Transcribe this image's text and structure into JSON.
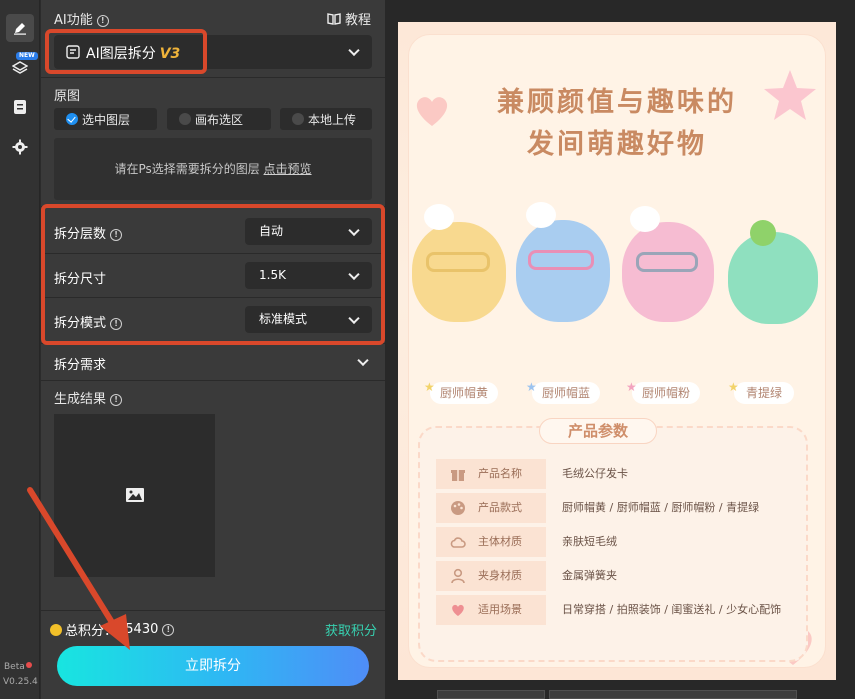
{
  "panel": {
    "ai_function_label": "AI功能",
    "tutorial_label": "教程",
    "function_select": {
      "label": "AI图层拆分",
      "version": "V3"
    },
    "source_label": "原图",
    "source_options": [
      "选中图层",
      "画布选区",
      "本地上传"
    ],
    "source_selected": "选中图层",
    "preview_hint": "请在Ps选择需要拆分的图层",
    "preview_link": "点击预览",
    "layers_label": "拆分层数",
    "layers_value": "自动",
    "size_label": "拆分尺寸",
    "size_value": "1.5K",
    "mode_label": "拆分模式",
    "mode_value": "标准模式",
    "requirements_label": "拆分需求",
    "result_label": "生成结果",
    "score_label": "总积分：",
    "score_value": "15430",
    "get_score_label": "获取积分",
    "go_button": "立即拆分"
  },
  "rail": {
    "new_badge": "NEW",
    "beta": "Beta",
    "version": "V0.25.4"
  },
  "poster": {
    "headline_1": "兼顾颜值与趣味的",
    "headline_2": "发间萌趣好物",
    "products": [
      "厨师帽黄",
      "厨师帽蓝",
      "厨师帽粉",
      "青提绿"
    ],
    "params_title": "产品参数",
    "params": [
      {
        "key": "产品名称",
        "value": "毛绒公仔发卡",
        "icon": "gift-icon"
      },
      {
        "key": "产品款式",
        "value": "厨师帽黄 / 厨师帽蓝 / 厨师帽粉 / 青提绿",
        "icon": "palette-icon"
      },
      {
        "key": "主体材质",
        "value": "亲肤短毛绒",
        "icon": "cloud-icon"
      },
      {
        "key": "夹身材质",
        "value": "金属弹簧夹",
        "icon": "user-icon"
      },
      {
        "key": "适用场景",
        "value": "日常穿搭 / 拍照装饰 / 闺蜜送礼 / 少女心配饰",
        "icon": "heart-icon"
      }
    ]
  },
  "colors": {
    "accent": "#d9482b",
    "brand_gradient_start": "#18e5e0",
    "brand_gradient_end": "#4f8df7"
  }
}
